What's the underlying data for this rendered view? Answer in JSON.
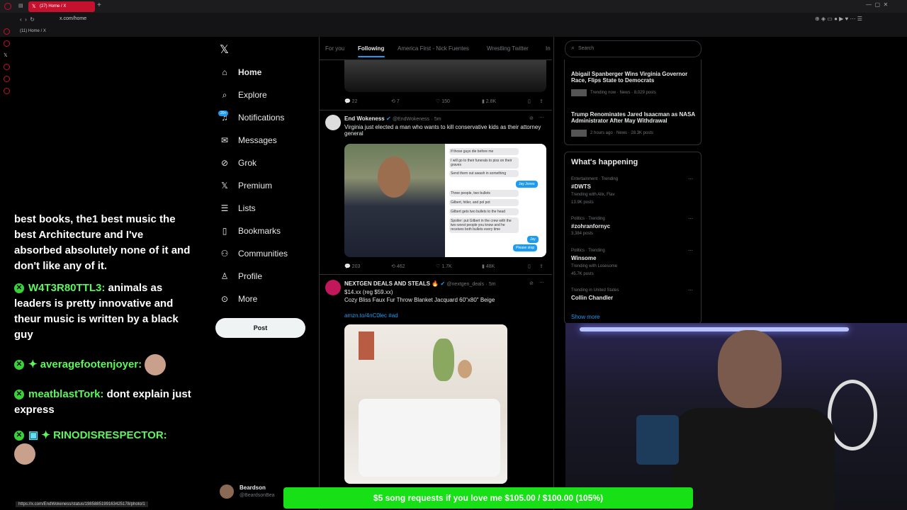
{
  "browser": {
    "tab_title": "(27) Home / X",
    "url": "x.com/home",
    "bookmark_label": "(11) Home / X",
    "status_url": "https://x.com/EndWokeness/status/1985885199163425178/photo/1"
  },
  "chat": {
    "line0": "best books, the1 best music the best Architecture and I've absorbed absolutely none of it and don't like any of it.",
    "msg1_user": "W4T3R80TTL3:",
    "msg1_text": "animals as leaders is pretty innovative and theur music is written by a black guy",
    "msg2_user": "averagefootenjoyer:",
    "msg3_user": "meatblastTork:",
    "msg3_text": "dont explain just express",
    "msg4_user": "RINODISRESPECTOR:"
  },
  "nav": {
    "home": "Home",
    "explore": "Explore",
    "notifications": "Notifications",
    "notif_badge": "20+",
    "messages": "Messages",
    "grok": "Grok",
    "premium": "Premium",
    "lists": "Lists",
    "bookmarks": "Bookmarks",
    "communities": "Communities",
    "profile": "Profile",
    "more": "More",
    "post": "Post"
  },
  "account": {
    "name": "Beardson",
    "handle": "@BeardsonBea"
  },
  "feed_tabs": [
    "For you",
    "Following",
    "America First - Nick Fuentes",
    "Wrestling Twitter",
    "In"
  ],
  "prev_tweet_actions": {
    "replies": "22",
    "reposts": "7",
    "likes": "150",
    "views": "2.8K"
  },
  "tweet1": {
    "name": "End Wokeness",
    "handle": "@EndWokeness",
    "time": "5m",
    "text": "Virginia just elected a man who wants to kill conservative kids as their attorney general",
    "chat_lines": [
      "If those guys die before me",
      "I will go to their funerals to piss on their graves",
      "Send them out awash in something",
      "Jay Jones",
      "Three people, two bullets",
      "Gilbert, hitler, and pol pot",
      "Gilbert gets two bullets to the head",
      "Spoiler: put Gilbert in the crew with the two worst people you know and he receives both bullets every time",
      "Jay",
      "Please stop"
    ],
    "replies": "203",
    "reposts": "462",
    "likes": "1.7K",
    "views": "48K"
  },
  "tweet2": {
    "name": "NEXTGEN DEALS AND STEALS",
    "handle": "@nextgen_deals",
    "time": "5m",
    "line1": "$14.xx (reg $59.xx)",
    "line2": "Cozy Bliss Faux Fur Throw Blanket Jacquard 60\"x80\" Beige",
    "link": "amzn.to/4nC0lec #ad"
  },
  "search_placeholder": "Search",
  "top_news": [
    {
      "title": "Abigail Spanberger Wins Virginia Governor Race, Flips State to Democrats",
      "meta": "Trending now · News · 8,029 posts"
    },
    {
      "title": "Trump Renominates Jared Isaacman as NASA Administrator After May Withdrawal",
      "meta": "2 hours ago · News · 28.3K posts"
    }
  ],
  "whats_happening": {
    "title": "What's happening",
    "trends": [
      {
        "cat": "Entertainment · Trending",
        "name": "#DWTS",
        "sub": "Trending with Allx, Flav",
        "posts": "13.9K posts"
      },
      {
        "cat": "Politics · Trending",
        "name": "#zohranfornyc",
        "sub": "",
        "posts": "3,384 posts"
      },
      {
        "cat": "Politics · Trending",
        "name": "Winsome",
        "sub": "Trending with Losesome",
        "posts": "45.7K posts"
      },
      {
        "cat": "Trending in United States",
        "name": "Collin Chandler",
        "sub": "",
        "posts": ""
      }
    ],
    "show_more": "Show more"
  },
  "banner": "$5 song requests if you love me $105.00 / $100.00 (105%)",
  "colors": {
    "accent": "#1d9bf0",
    "chat_green": "#5cf55c",
    "banner_green": "#17e017",
    "tab_red": "#c4122e"
  }
}
